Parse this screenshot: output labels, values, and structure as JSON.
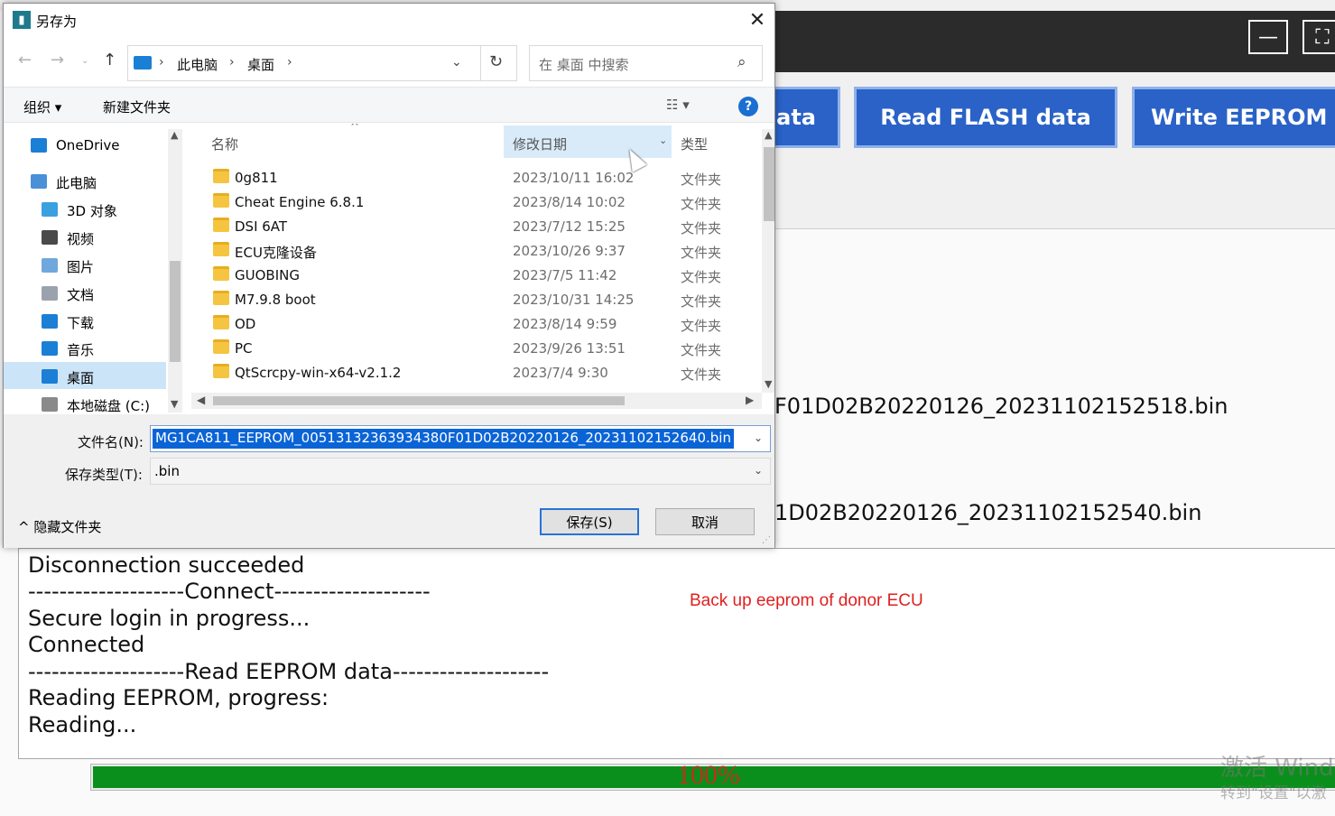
{
  "app": {
    "buttons": {
      "read_eeprom_partial": "ata",
      "read_flash": "Read FLASH data",
      "write_eeprom_partial": "Write EEPROM d"
    },
    "window_controls": {
      "minimize": "—",
      "fullscreen": "⛶"
    },
    "file_lines": [
      "F01D02B20220126_20231102152518.bin",
      "1D02B20220126_20231102152540.bin"
    ],
    "log": [
      "Disconnection succeeded",
      "--------------------Connect--------------------",
      "Secure login in progress...",
      "Connected",
      "--------------------Read EEPROM data--------------------",
      "Reading EEPROM, progress:",
      "Reading..."
    ],
    "annotation": "Back up eeprom of donor ECU",
    "progress": {
      "value": 1.0,
      "label": "100%",
      "fill_color": "#0a8f1c"
    },
    "watermark": {
      "line1": "激活 Windo",
      "line2": "转到\"设置\"以激"
    }
  },
  "dialog": {
    "title": "另存为",
    "close": "✕",
    "address": {
      "crumbs": [
        "此电脑",
        "桌面"
      ],
      "separator": "›"
    },
    "search_placeholder": "在 桌面 中搜索",
    "toolbar": {
      "organize": "组织 ▾",
      "new_folder": "新建文件夹",
      "view": "☷ ▾",
      "help": "?"
    },
    "nav_tree": [
      {
        "label": "OneDrive",
        "icon": "cloud-icon",
        "color": "#1b7fd6"
      },
      {
        "label": "此电脑",
        "icon": "computer-icon",
        "color": "#4a90d9"
      },
      {
        "label": "3D 对象",
        "icon": "cube-icon",
        "color": "#3aa0e0"
      },
      {
        "label": "视频",
        "icon": "video-icon",
        "color": "#4a4a4a"
      },
      {
        "label": "图片",
        "icon": "picture-icon",
        "color": "#6fa8dc"
      },
      {
        "label": "文档",
        "icon": "document-icon",
        "color": "#9aa3ad"
      },
      {
        "label": "下载",
        "icon": "download-icon",
        "color": "#1b7fd6"
      },
      {
        "label": "音乐",
        "icon": "music-icon",
        "color": "#1b7fd6"
      },
      {
        "label": "桌面",
        "icon": "desktop-icon",
        "color": "#1b7fd6",
        "selected": true
      },
      {
        "label": "本地磁盘 (C:)",
        "icon": "drive-icon",
        "color": "#8a8a8a"
      }
    ],
    "columns": {
      "name": "名称",
      "date": "修改日期",
      "type": "类型"
    },
    "files": [
      {
        "name": "0g811",
        "date": "2023/10/11 16:02",
        "type": "文件夹"
      },
      {
        "name": "Cheat Engine 6.8.1",
        "date": "2023/8/14 10:02",
        "type": "文件夹"
      },
      {
        "name": "DSI 6AT",
        "date": "2023/7/12 15:25",
        "type": "文件夹"
      },
      {
        "name": "ECU克隆设备",
        "date": "2023/10/26 9:37",
        "type": "文件夹"
      },
      {
        "name": "GUOBING",
        "date": "2023/7/5 11:42",
        "type": "文件夹"
      },
      {
        "name": "M7.9.8 boot",
        "date": "2023/10/31 14:25",
        "type": "文件夹"
      },
      {
        "name": "OD",
        "date": "2023/8/14 9:59",
        "type": "文件夹"
      },
      {
        "name": "PC",
        "date": "2023/9/26 13:51",
        "type": "文件夹"
      },
      {
        "name": "QtScrcpy-win-x64-v2.1.2",
        "date": "2023/7/4 9:30",
        "type": "文件夹"
      }
    ],
    "filename_label": "文件名(N):",
    "filename_value": "MG1CA811_EEPROM_00513132363934380F01D02B20220126_20231102152640.bin",
    "filetype_label": "保存类型(T):",
    "filetype_value": ".bin",
    "hide_folders": "隐藏文件夹",
    "save": "保存(S)",
    "cancel": "取消"
  }
}
